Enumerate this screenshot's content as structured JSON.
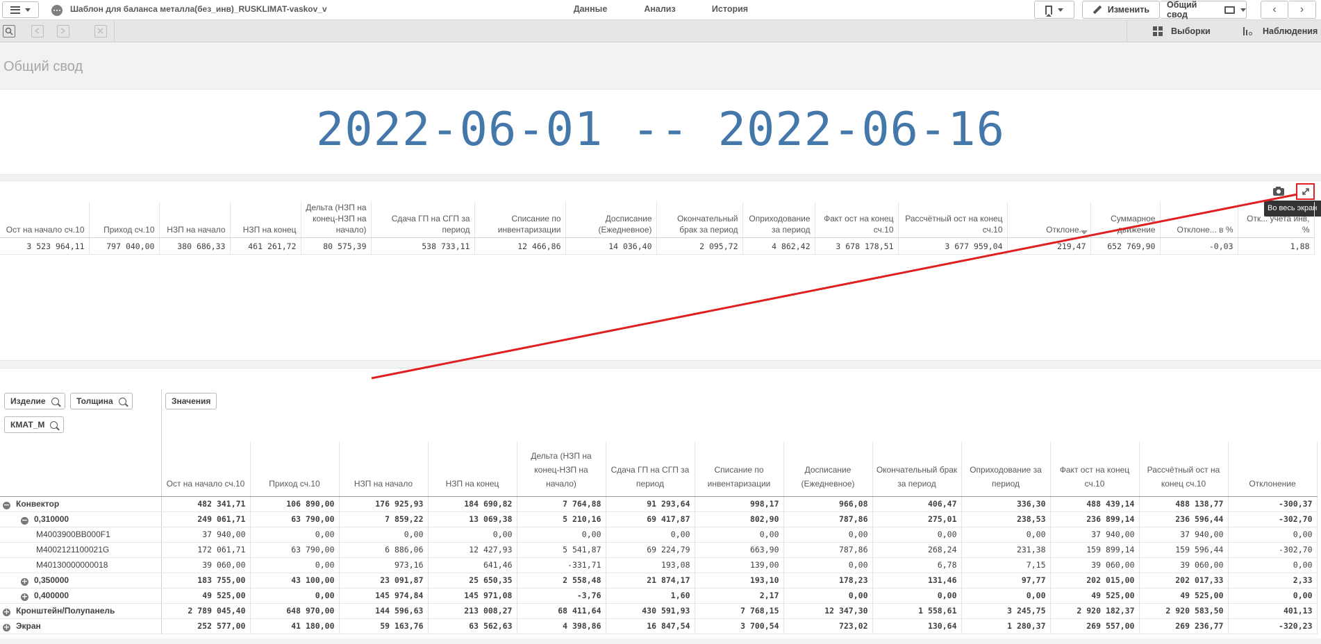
{
  "app": {
    "title": "Шаблон для баланса металла(без_инв)_RUSKLIMAT-vaskov_v",
    "tabs": [
      "Данные",
      "Анализ",
      "История"
    ],
    "active_tab": "Анализ",
    "edit_label": "Изменить",
    "sheet_selector_label": "Общий свод",
    "selections_label": "Выборки",
    "insights_label": "Наблюдения"
  },
  "sheet": {
    "title": "Общий свод",
    "kpi_text": "2022-06-01 -- 2022-06-16",
    "expand_tooltip": "Во весь экран"
  },
  "summary_table": {
    "headers": [
      "Ост на начало сч.10",
      "Приход сч.10",
      "НЗП на начало",
      "НЗП на конец",
      "Дельта (НЗП на конец-НЗП на начало)",
      "Сдача ГП на СГП за период",
      "Списание по инвентаризации",
      "Досписание (Ежедневное)",
      "Окончательный брак за период",
      "Оприходование за период",
      "Факт ост на конец сч.10",
      "Рассчётный ост на конец сч.10",
      "Отклоне...",
      "Суммарное движение",
      "Отклоне... в %",
      "Отк... учета инв, %"
    ],
    "values": [
      "3 523 964,11",
      "797 040,00",
      "380 686,33",
      "461 261,72",
      "80 575,39",
      "538 733,11",
      "12 466,86",
      "14 036,40",
      "2 095,72",
      "4 862,42",
      "3 678 178,51",
      "3 677 959,04",
      "219,47",
      "652 769,90",
      "-0,03",
      "1,88"
    ]
  },
  "pivot": {
    "dimensions": [
      "Изделие",
      "Толщина",
      "КМАТ_М"
    ],
    "values_label": "Значения",
    "headers": [
      "Ост на начало сч.10",
      "Приход сч.10",
      "НЗП на начало",
      "НЗП на конец",
      "Дельта (НЗП на конец-НЗП на начало)",
      "Сдача ГП на СГП за период",
      "Списание по инвентаризации",
      "Досписание (Ежедневное)",
      "Окончательный брак за период",
      "Оприходование за период",
      "Факт ост на конец сч.10",
      "Рассчётный ост на конец сч.10",
      "Отклонение"
    ],
    "rows": [
      {
        "label": "Конвектор",
        "level": 0,
        "toggle": "−",
        "bold": true,
        "cells": [
          "482 341,71",
          "106 890,00",
          "176 925,93",
          "184 690,82",
          "7 764,88",
          "91 293,64",
          "998,17",
          "966,08",
          "406,47",
          "336,30",
          "488 439,14",
          "488 138,77",
          "-300,37"
        ]
      },
      {
        "label": "0,310000",
        "level": 1,
        "toggle": "−",
        "bold": true,
        "cells": [
          "249 061,71",
          "63 790,00",
          "7 859,22",
          "13 069,38",
          "5 210,16",
          "69 417,87",
          "802,90",
          "787,86",
          "275,01",
          "238,53",
          "236 899,14",
          "236 596,44",
          "-302,70"
        ]
      },
      {
        "label": "M4003900BB000F1",
        "level": 2,
        "toggle": "",
        "bold": false,
        "cells": [
          "37 940,00",
          "0,00",
          "0,00",
          "0,00",
          "0,00",
          "0,00",
          "0,00",
          "0,00",
          "0,00",
          "0,00",
          "37 940,00",
          "37 940,00",
          "0,00"
        ]
      },
      {
        "label": "M4002121100021G",
        "level": 2,
        "toggle": "",
        "bold": false,
        "cells": [
          "172 061,71",
          "63 790,00",
          "6 886,06",
          "12 427,93",
          "5 541,87",
          "69 224,79",
          "663,90",
          "787,86",
          "268,24",
          "231,38",
          "159 899,14",
          "159 596,44",
          "-302,70"
        ]
      },
      {
        "label": "M40130000000018",
        "level": 2,
        "toggle": "",
        "bold": false,
        "cells": [
          "39 060,00",
          "0,00",
          "973,16",
          "641,46",
          "-331,71",
          "193,08",
          "139,00",
          "0,00",
          "6,78",
          "7,15",
          "39 060,00",
          "39 060,00",
          "0,00"
        ]
      },
      {
        "label": "0,350000",
        "level": 1,
        "toggle": "+",
        "bold": true,
        "cells": [
          "183 755,00",
          "43 100,00",
          "23 091,87",
          "25 650,35",
          "2 558,48",
          "21 874,17",
          "193,10",
          "178,23",
          "131,46",
          "97,77",
          "202 015,00",
          "202 017,33",
          "2,33"
        ]
      },
      {
        "label": "0,400000",
        "level": 1,
        "toggle": "+",
        "bold": true,
        "cells": [
          "49 525,00",
          "0,00",
          "145 974,84",
          "145 971,08",
          "-3,76",
          "1,60",
          "2,17",
          "0,00",
          "0,00",
          "0,00",
          "49 525,00",
          "49 525,00",
          "0,00"
        ]
      },
      {
        "label": "Кронштейн/Полупанель",
        "level": 0,
        "toggle": "+",
        "bold": true,
        "cells": [
          "2 789 045,40",
          "648 970,00",
          "144 596,63",
          "213 008,27",
          "68 411,64",
          "430 591,93",
          "7 768,15",
          "12 347,30",
          "1 558,61",
          "3 245,75",
          "2 920 182,37",
          "2 920 583,50",
          "401,13"
        ]
      },
      {
        "label": "Экран",
        "level": 0,
        "toggle": "+",
        "bold": true,
        "cells": [
          "252 577,00",
          "41 180,00",
          "59 163,76",
          "63 562,63",
          "4 398,86",
          "16 847,54",
          "3 700,54",
          "723,02",
          "130,64",
          "1 280,37",
          "269 557,00",
          "269 236,77",
          "-320,23"
        ]
      }
    ]
  },
  "colors": {
    "kpi": "#4477aa",
    "annotation": "#e02020",
    "active_tab_underline": "#f5a623"
  }
}
